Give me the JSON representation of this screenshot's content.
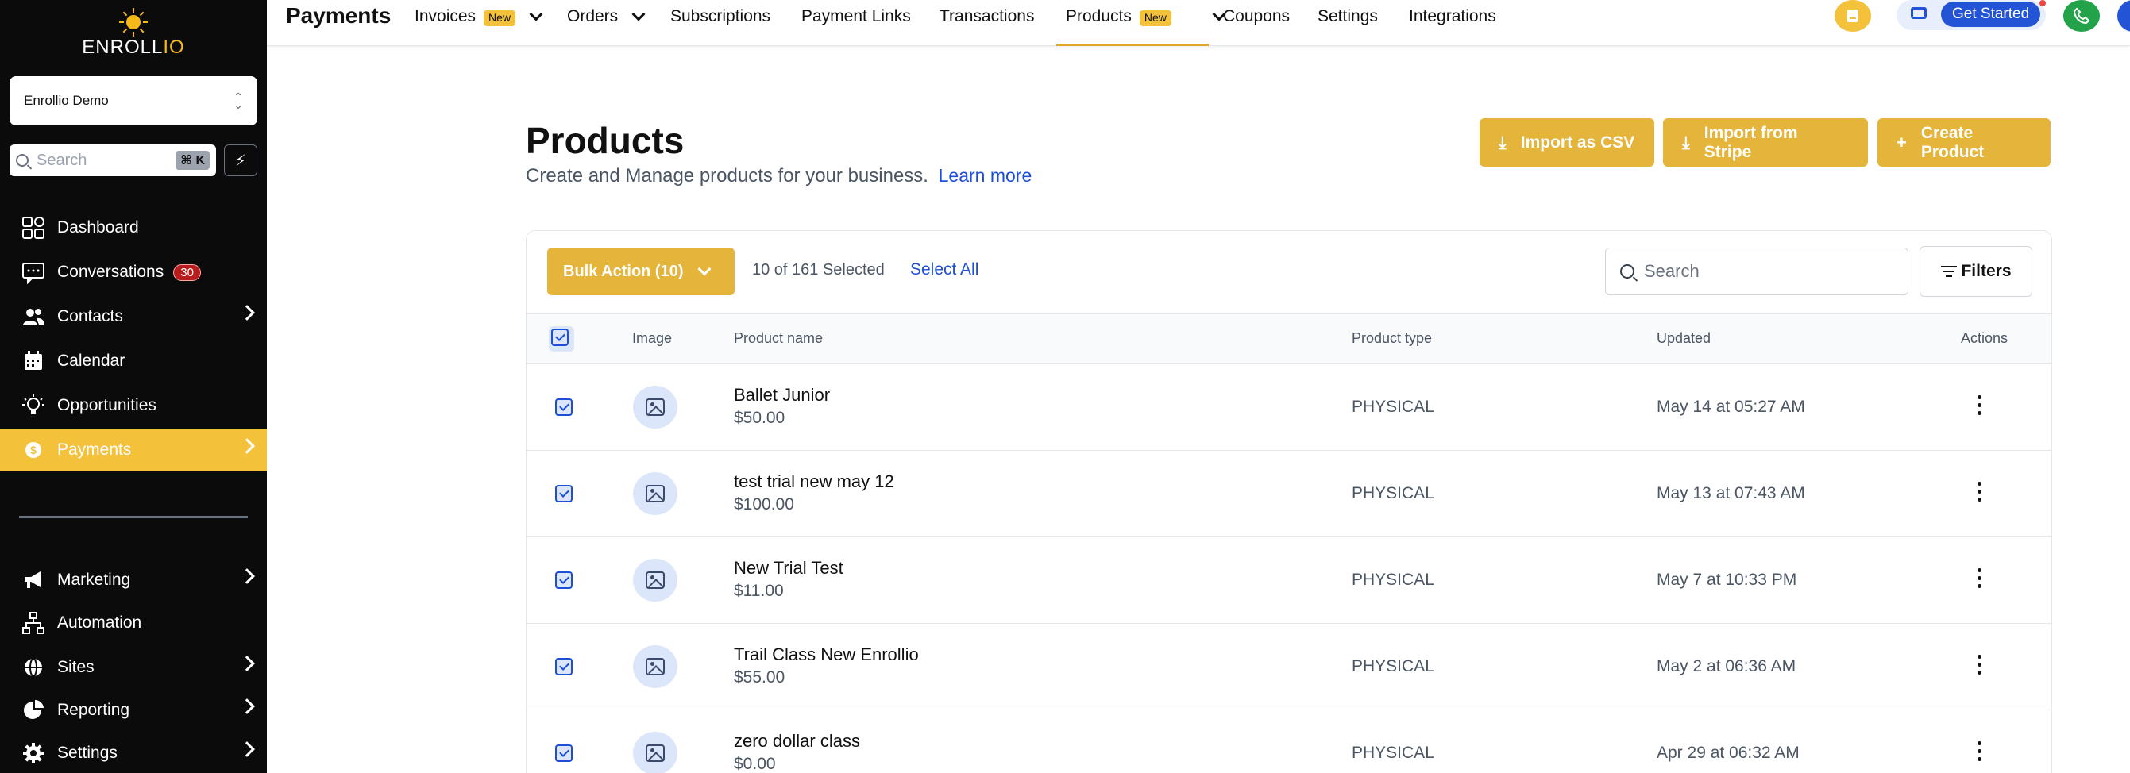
{
  "brand": {
    "name_main": "ENROLL",
    "name_accent": "IO",
    "accent_color": "#f3c13a"
  },
  "account": {
    "name": "Enrollio Demo"
  },
  "sidebar_search": {
    "placeholder": "Search",
    "shortcut": "⌘ K"
  },
  "nav": [
    {
      "label": "Dashboard",
      "icon": "dashboard-icon"
    },
    {
      "label": "Conversations",
      "icon": "chat-icon",
      "badge": "30"
    },
    {
      "label": "Contacts",
      "icon": "contacts-icon"
    },
    {
      "label": "Calendar",
      "icon": "calendar-icon"
    },
    {
      "label": "Opportunities",
      "icon": "lightbulb-icon"
    },
    {
      "label": "Payments",
      "icon": "payments-icon"
    },
    {
      "label": "Marketing",
      "icon": "megaphone-icon"
    },
    {
      "label": "Automation",
      "icon": "automation-icon"
    },
    {
      "label": "Sites",
      "icon": "globe-icon"
    },
    {
      "label": "Reporting",
      "icon": "pie-chart-icon"
    },
    {
      "label": "Settings",
      "icon": "gear-icon"
    }
  ],
  "topbar": {
    "title": "Payments",
    "tabs": [
      {
        "label": "Invoices",
        "new": "New"
      },
      {
        "label": "Orders"
      },
      {
        "label": "Subscriptions"
      },
      {
        "label": "Payment Links"
      },
      {
        "label": "Transactions"
      },
      {
        "label": "Products",
        "new": "New"
      },
      {
        "label": "Coupons"
      },
      {
        "label": "Settings"
      },
      {
        "label": "Integrations"
      }
    ],
    "get_started": "Get Started"
  },
  "page": {
    "title": "Products",
    "subtitle": "Create and Manage products for your business.",
    "learn_more": "Learn more",
    "import_csv": "Import as CSV",
    "import_stripe": "Import from Stripe",
    "create_product": "Create Product"
  },
  "toolbar": {
    "bulk_action": "Bulk Action (10)",
    "selected": "10 of 161 Selected",
    "select_all": "Select All",
    "search_placeholder": "Search",
    "filters": "Filters"
  },
  "table": {
    "columns": [
      "Image",
      "Product name",
      "Product type",
      "Updated",
      "Actions"
    ],
    "rows": [
      {
        "name": "Ballet Junior",
        "price": "$50.00",
        "type": "PHYSICAL",
        "updated": "May 14 at 05:27 AM"
      },
      {
        "name": "test trial new may 12",
        "price": "$100.00",
        "type": "PHYSICAL",
        "updated": "May 13 at 07:43 AM"
      },
      {
        "name": "New Trial Test",
        "price": "$11.00",
        "type": "PHYSICAL",
        "updated": "May 7 at 10:33 PM"
      },
      {
        "name": "Trail Class New Enrollio",
        "price": "$55.00",
        "type": "PHYSICAL",
        "updated": "May 2 at 06:36 AM"
      },
      {
        "name": "zero dollar class",
        "price": "$0.00",
        "type": "PHYSICAL",
        "updated": "Apr 29 at 06:32 AM"
      }
    ]
  }
}
